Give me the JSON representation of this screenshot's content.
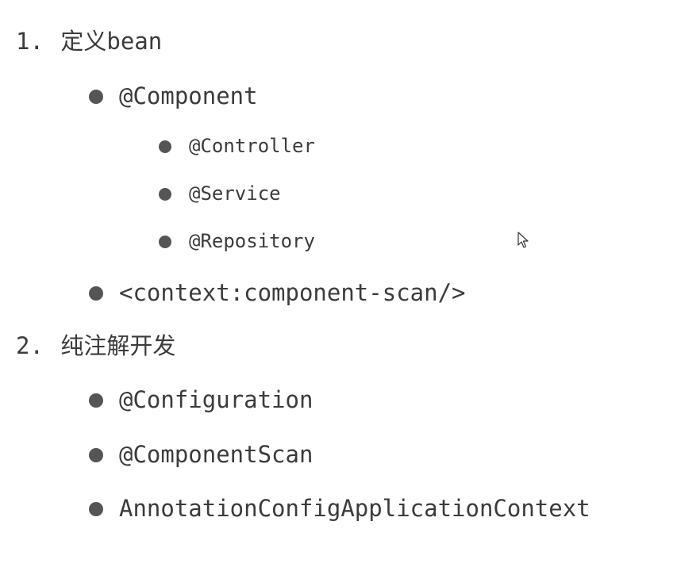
{
  "sections": [
    {
      "number": "1.",
      "title": "定义bean",
      "items": [
        {
          "label": "@Component",
          "children": [
            "@Controller",
            "@Service",
            "@Repository"
          ]
        },
        {
          "label": "<context:component-scan/>"
        }
      ]
    },
    {
      "number": "2.",
      "title": "纯注解开发",
      "items": [
        {
          "label": "@Configuration"
        },
        {
          "label": "@ComponentScan"
        },
        {
          "label": "AnnotationConfigApplicationContext"
        }
      ]
    }
  ],
  "cursor_icon": "mouse-pointer-icon"
}
